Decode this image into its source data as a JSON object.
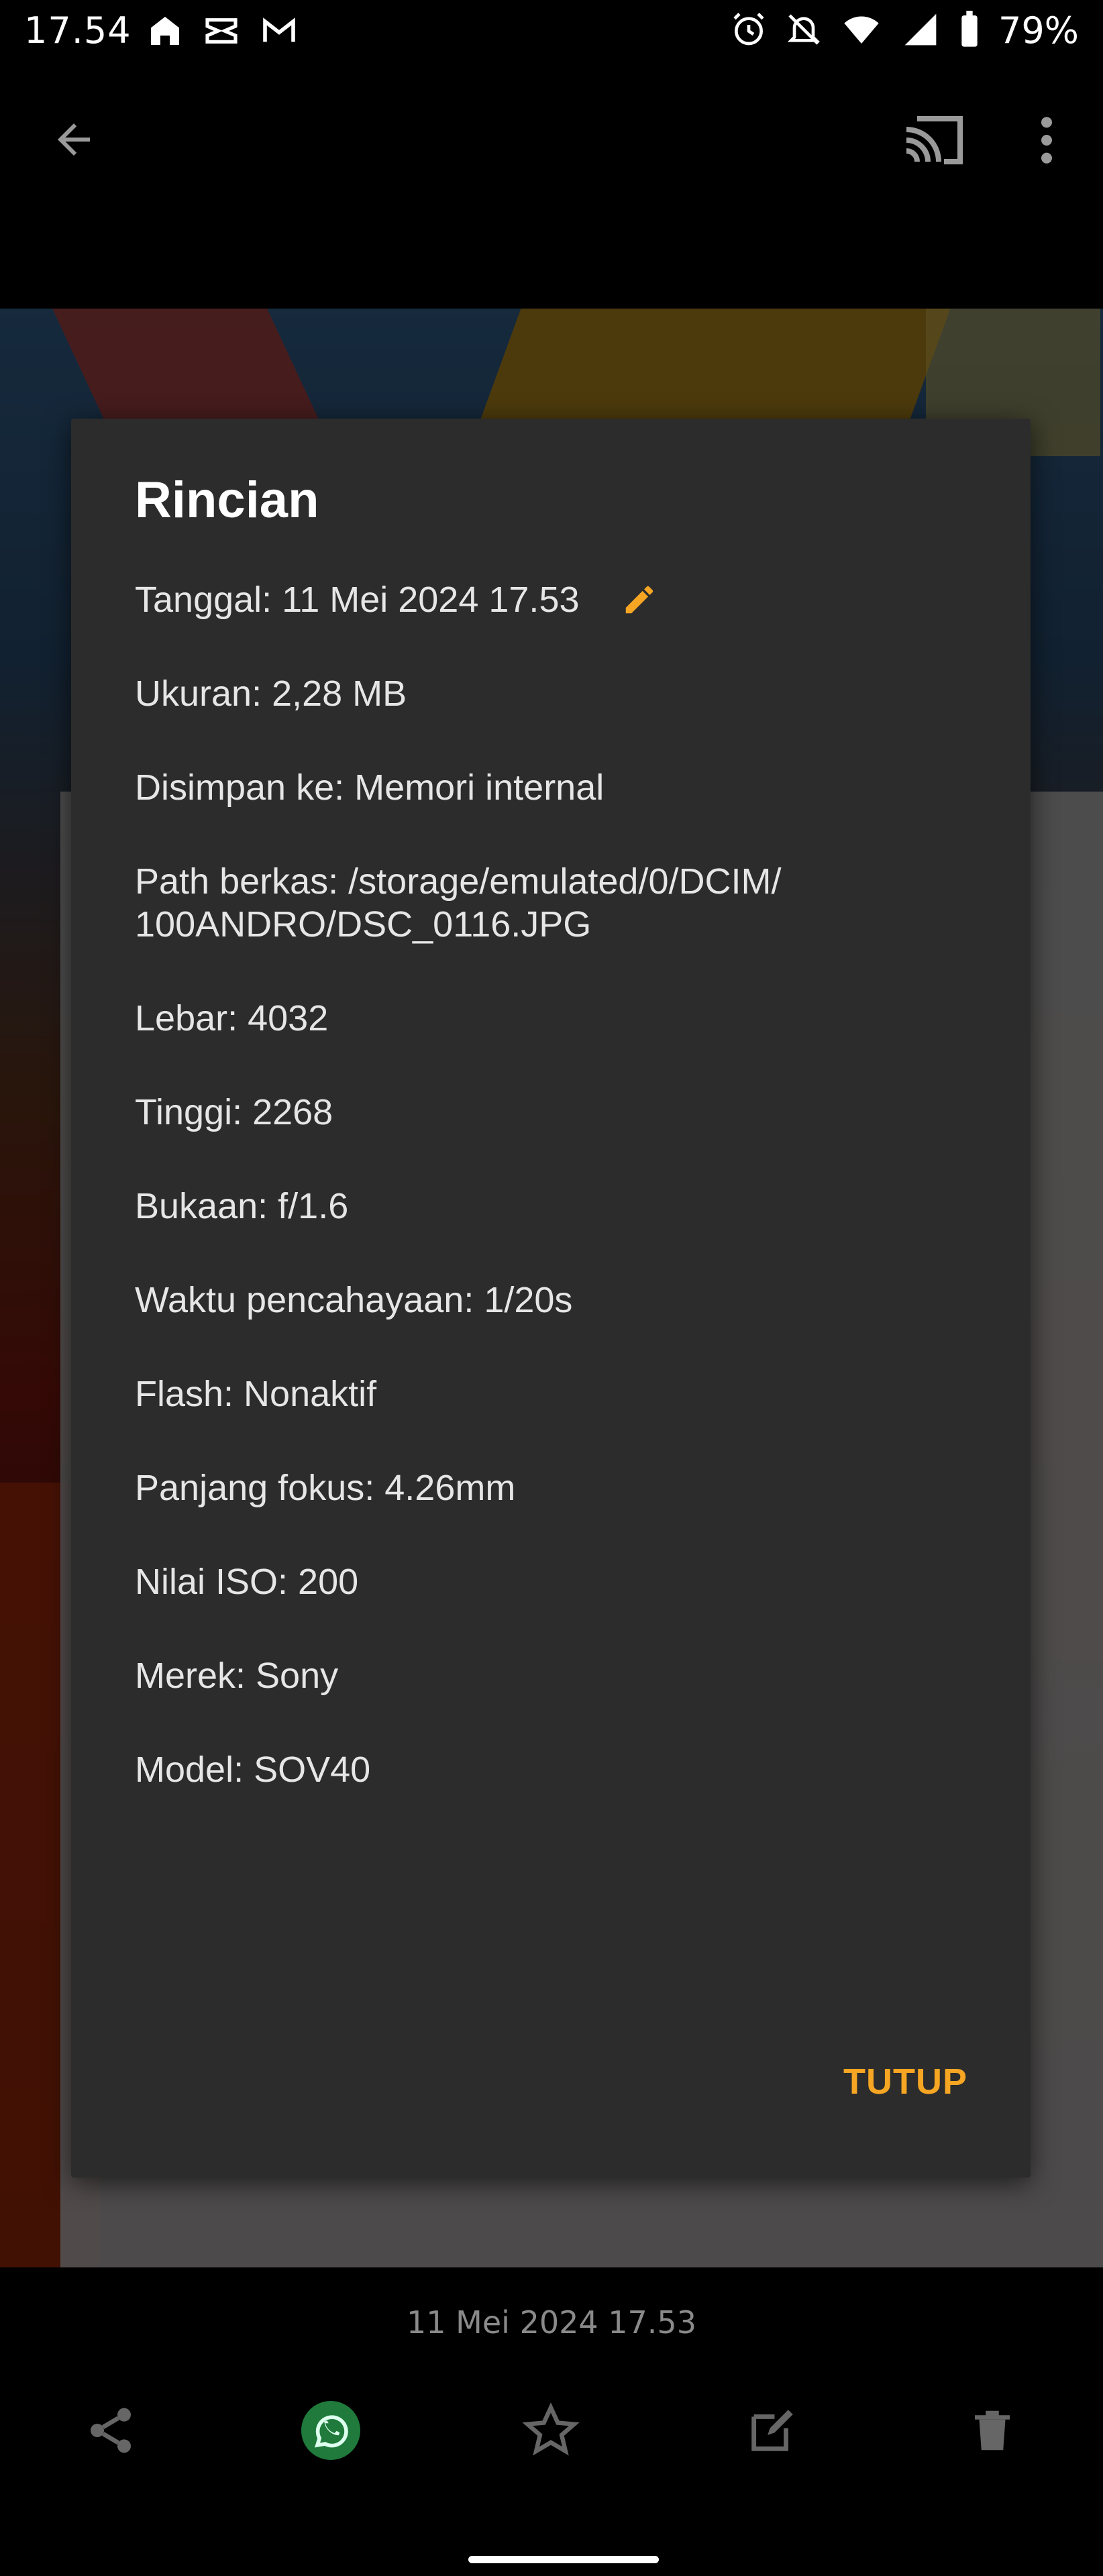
{
  "status_bar": {
    "time": "17.54",
    "battery": "79%",
    "left_icons": [
      "home-lock-icon",
      "capcut-icon",
      "gmail-icon"
    ],
    "right_icons": [
      "alarm-icon",
      "bell-off-icon",
      "wifi-icon",
      "signal-icon",
      "battery-icon"
    ]
  },
  "app_bar": {
    "back_icon": "arrow-back-icon",
    "cast_icon": "cast-icon",
    "menu_icon": "more-vert-icon"
  },
  "dialog": {
    "title": "Rincian",
    "details": [
      "Tanggal: 11 Mei 2024 17.53",
      "Ukuran: 2,28 MB",
      "Disimpan ke: Memori internal",
      "Path berkas: /storage/emulated/0/DCIM/",
      "100ANDRO/DSC_0116.JPG",
      "Lebar: 4032",
      "Tinggi: 2268",
      "Bukaan: f/1.6",
      "Waktu pencahayaan: 1/20s",
      "Flash: Nonaktif",
      "Panjang fokus: 4.26mm",
      "Nilai ISO: 200",
      "Merek: Sony",
      "Model: SOV40"
    ],
    "close_label": "TUTUP",
    "accent_color": "#f6a623"
  },
  "photo_footer": {
    "date": "11 Mei 2024 17.53",
    "actions": [
      "share-icon",
      "whatsapp-icon",
      "star-icon",
      "edit-icon",
      "delete-icon"
    ]
  }
}
